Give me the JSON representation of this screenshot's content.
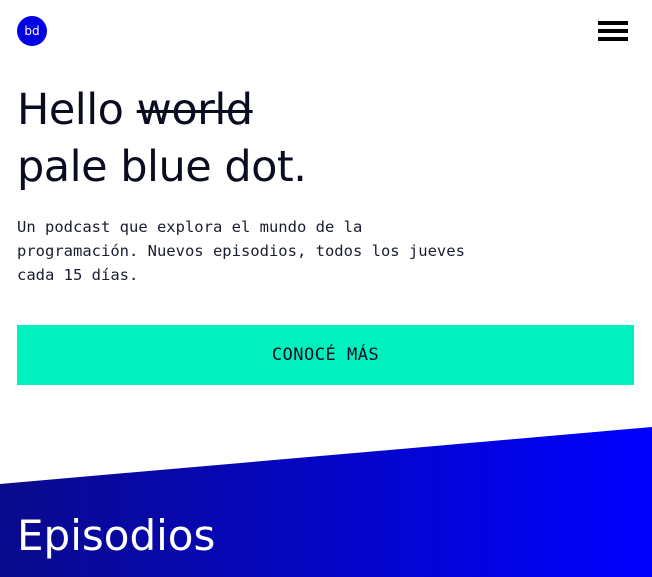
{
  "header": {
    "logo_text": "bd",
    "menu_icon": "hamburger-menu-icon"
  },
  "hero": {
    "hello": "Hello",
    "struck_word": "world",
    "line2": "pale blue dot.",
    "tagline": "Un podcast que explora el mundo de la programación. Nuevos episodios, todos los jueves cada 15 días.",
    "cta_label": "CONOCÉ MÁS"
  },
  "episodes": {
    "title": "Episodios"
  },
  "colors": {
    "brand_blue": "#0000e6",
    "cta_green": "#00f0c0",
    "gradient_dark": "#0a0a8c",
    "gradient_bright": "#0000ff"
  }
}
